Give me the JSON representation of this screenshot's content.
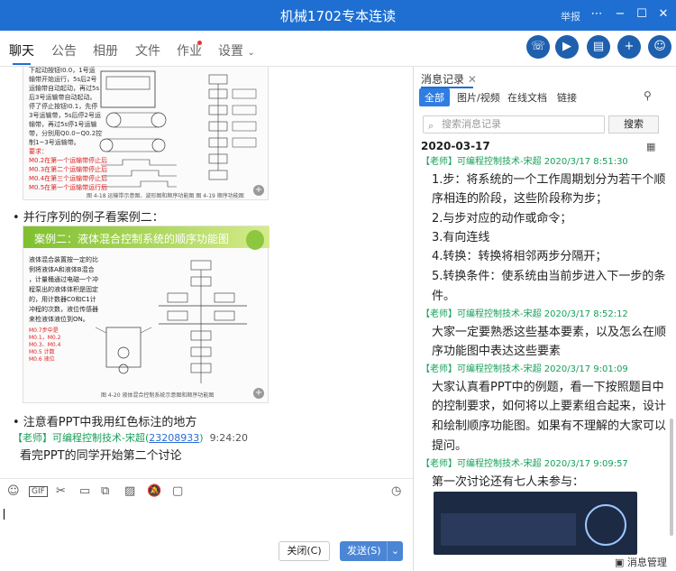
{
  "window": {
    "title": "机械1702专本连读",
    "report_label": "举报"
  },
  "tabs": [
    {
      "label": "聊天",
      "active": true
    },
    {
      "label": "公告",
      "active": false
    },
    {
      "label": "相册",
      "active": false
    },
    {
      "label": "文件",
      "active": false
    },
    {
      "label": "作业",
      "active": false
    },
    {
      "label": "设置",
      "active": false
    }
  ],
  "chat": {
    "slide1": {
      "text_lines": [
        "下起动按钮I0.0，1号运",
        "输带开始运行，5s后2号",
        "运输带自动起动，再过5s",
        "后3号运输带自动起动。",
        "停了停止按钮I0.1，先停",
        "3号运输带，5s后停2号运",
        "输带，再过5s停1号运输",
        "带，分别用Q0.0~Q0.2控",
        "制1~3号运输带。"
      ],
      "red_lines": [
        "要求：",
        "M0.2在第一个运输带停止后",
        "M0.3在第二个运输带停止后",
        "M0.4在第三个运输带停止后",
        "M0.5在第一个运输带运行后"
      ],
      "caption": "图 4-18  运输带示意图、波形图和顺序功能图  图 4-19  顺序功能图"
    },
    "heading_parallel": "• 并行序列的例子看案例二：",
    "slide2": {
      "title": "案例二：液体混合控制系统的顺序功能图",
      "bullets": [
        "液体混合装置按一定的比",
        "例将液体A和液体B混合",
        "，计量桶通过电磁一个冲",
        "程泵出的液体体积是固定",
        "的，用计数器C0和C1计",
        "冲程的次数，液位传感器",
        "来检液体液位到ON。"
      ],
      "caption": "图 4-20  液体混合控制系统示意图和顺序功能图"
    },
    "note_red": "• 注意看PPT中我用红色标注的地方",
    "sender": {
      "name": "【老师】可编程控制技术-宋超",
      "id": "23208933",
      "time": "9:24:20"
    },
    "message": "看完PPT的同学开始第二个讨论"
  },
  "toolbar_icons": [
    "emoji-icon",
    "gif-icon",
    "scissors-icon",
    "folder-icon",
    "image-icon",
    "picture-icon",
    "mute-icon",
    "clock-icon"
  ],
  "buttons": {
    "close": "关闭(C)",
    "send": "发送(S)"
  },
  "history": {
    "title": "消息记录",
    "filters": [
      "全部",
      "图片/视频",
      "在线文档",
      "链接"
    ],
    "search_placeholder": "搜索消息记录",
    "search_btn": "搜索",
    "date": "2020-03-17",
    "first_sender": "【老师】可编程控制技术-宋超 2020/3/17 8:51:30",
    "first_lines": [
      "1.步：将系统的一个工作周期划分为若干个顺",
      "序相连的阶段，这些阶段称为步；",
      "2.与步对应的动作或命令；",
      "3.有向连线",
      "4.转换：转换将相邻两步分隔开；",
      "5.转换条件：使系统由当前步进入下一步的条",
      "件。"
    ],
    "second_sender": "【老师】可编程控制技术-宋超 2020/3/17 8:52:12",
    "second_lines": [
      "大家一定要熟悉这些基本要素，以及怎么在顺",
      "序功能图中表达这些要素"
    ],
    "third_sender": "【老师】可编程控制技术-宋超 2020/3/17 9:01:09",
    "third_lines": [
      "大家认真看PPT中的例题，看一下按照题目中",
      "的控制要求，如何将以上要素组合起来，设计",
      "和绘制顺序功能图。如果有不理解的大家可以",
      "提问。"
    ],
    "fourth_sender": "【老师】可编程控制技术-宋超 2020/3/17 9:09:57",
    "fourth_line": "第一次讨论还有七人未参与：",
    "footer": "消息管理"
  }
}
